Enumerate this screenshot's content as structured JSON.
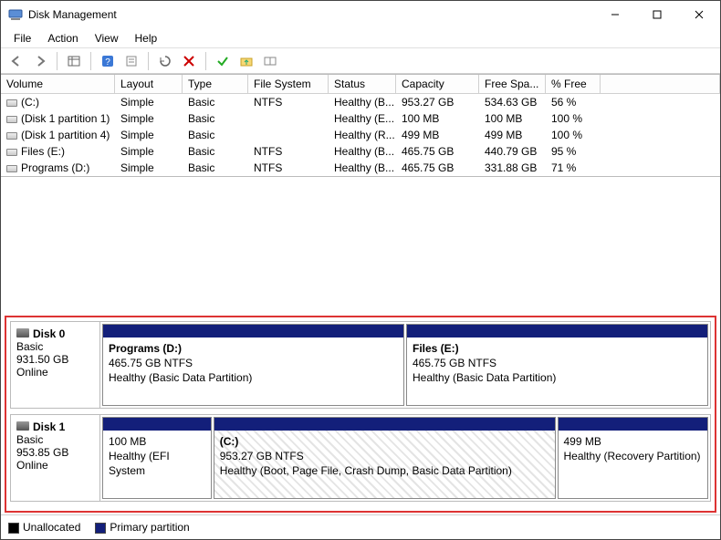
{
  "window": {
    "title": "Disk Management"
  },
  "menubar": {
    "file": "File",
    "action": "Action",
    "view": "View",
    "help": "Help"
  },
  "table": {
    "headers": {
      "volume": "Volume",
      "layout": "Layout",
      "type": "Type",
      "fs": "File System",
      "status": "Status",
      "capacity": "Capacity",
      "free": "Free Spa...",
      "pct": "% Free"
    },
    "rows": [
      {
        "volume": "(C:)",
        "layout": "Simple",
        "type": "Basic",
        "fs": "NTFS",
        "status": "Healthy (B...",
        "capacity": "953.27 GB",
        "free": "534.63 GB",
        "pct": "56 %"
      },
      {
        "volume": "(Disk 1 partition 1)",
        "layout": "Simple",
        "type": "Basic",
        "fs": "",
        "status": "Healthy (E...",
        "capacity": "100 MB",
        "free": "100 MB",
        "pct": "100 %"
      },
      {
        "volume": "(Disk 1 partition 4)",
        "layout": "Simple",
        "type": "Basic",
        "fs": "",
        "status": "Healthy (R...",
        "capacity": "499 MB",
        "free": "499 MB",
        "pct": "100 %"
      },
      {
        "volume": "Files (E:)",
        "layout": "Simple",
        "type": "Basic",
        "fs": "NTFS",
        "status": "Healthy (B...",
        "capacity": "465.75 GB",
        "free": "440.79 GB",
        "pct": "95 %"
      },
      {
        "volume": "Programs  (D:)",
        "layout": "Simple",
        "type": "Basic",
        "fs": "NTFS",
        "status": "Healthy (B...",
        "capacity": "465.75 GB",
        "free": "331.88 GB",
        "pct": "71 %"
      }
    ]
  },
  "disks": [
    {
      "name": "Disk 0",
      "kind": "Basic",
      "size": "931.50 GB",
      "state": "Online",
      "parts": [
        {
          "title": "Programs   (D:)",
          "line2": "465.75 GB NTFS",
          "line3": "Healthy (Basic Data Partition)",
          "flex": 1,
          "hatched": false
        },
        {
          "title": "Files  (E:)",
          "line2": "465.75 GB NTFS",
          "line3": "Healthy (Basic Data Partition)",
          "flex": 1,
          "hatched": false
        }
      ]
    },
    {
      "name": "Disk 1",
      "kind": "Basic",
      "size": "953.85 GB",
      "state": "Online",
      "parts": [
        {
          "title": "",
          "line2": "100 MB",
          "line3": "Healthy (EFI System",
          "flex": 0.18,
          "hatched": false
        },
        {
          "title": "(C:)",
          "line2": "953.27 GB NTFS",
          "line3": "Healthy (Boot, Page File, Crash Dump, Basic Data Partition)",
          "flex": 0.57,
          "hatched": true
        },
        {
          "title": "",
          "line2": "499 MB",
          "line3": "Healthy (Recovery Partition)",
          "flex": 0.25,
          "hatched": false
        }
      ]
    }
  ],
  "legend": {
    "unallocated": "Unallocated",
    "primary": "Primary partition"
  }
}
